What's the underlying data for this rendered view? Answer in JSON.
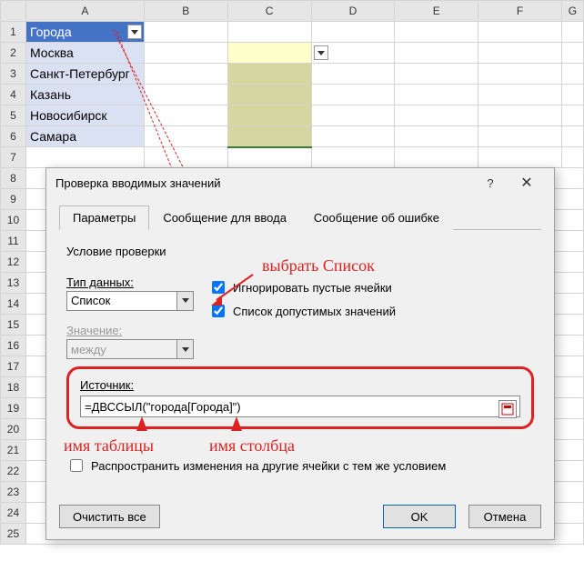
{
  "grid": {
    "col_headers": [
      "A",
      "B",
      "C",
      "D",
      "E",
      "F",
      "G"
    ],
    "row_headers": [
      "1",
      "2",
      "3",
      "4",
      "5",
      "6",
      "7",
      "8",
      "9",
      "10",
      "11",
      "12",
      "13",
      "14",
      "15",
      "16",
      "17",
      "18",
      "19",
      "20",
      "21",
      "22",
      "23",
      "24",
      "25"
    ],
    "table_header": "Города",
    "cities": [
      "Москва",
      "Санкт-Петербург",
      "Казань",
      "Новосибирск",
      "Самара"
    ]
  },
  "dialog": {
    "title": "Проверка вводимых значений",
    "tabs": [
      "Параметры",
      "Сообщение для ввода",
      "Сообщение об ошибке"
    ],
    "group": "Условие проверки",
    "type_label": "Тип данных:",
    "type_value": "Список",
    "value_label": "Значение:",
    "value_value": "между",
    "ignore_blank": "Игнорировать пустые ячейки",
    "incell_dropdown": "Список допустимых значений",
    "source_label": "Источник:",
    "source_value": "=ДВССЫЛ(\"города[Города]\")",
    "propagate": "Распространить изменения на другие ячейки с тем же условием",
    "clear_all": "Очистить все",
    "ok": "OK",
    "cancel": "Отмена",
    "help": "?"
  },
  "annotations": {
    "choose_list": "выбрать Список",
    "table_name": "имя таблицы",
    "column_name": "имя столбца"
  }
}
